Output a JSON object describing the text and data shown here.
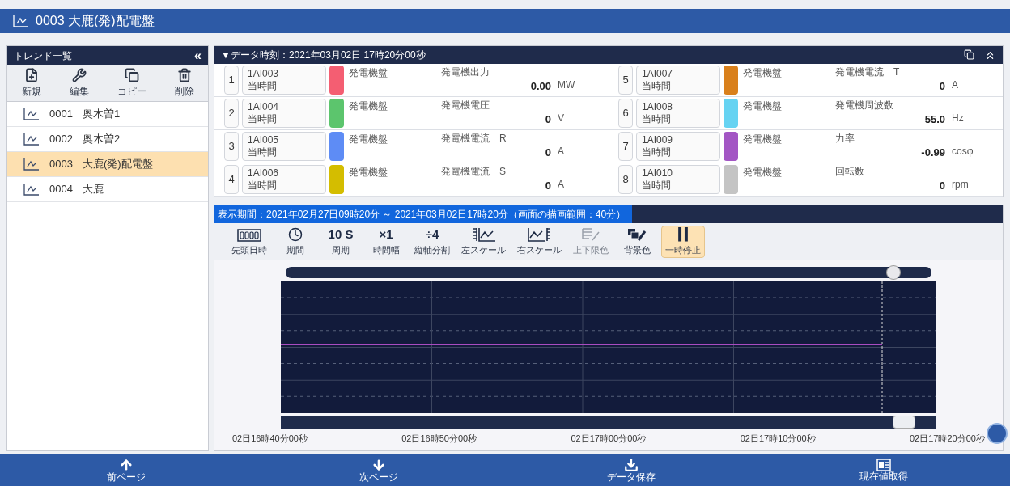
{
  "window": {
    "title": "0003 大鹿(発)配電盤"
  },
  "sidebar": {
    "title": "トレンド一覧",
    "collapse": "«",
    "tools": [
      {
        "kind": "new",
        "label": "新規"
      },
      {
        "kind": "edit",
        "label": "編集"
      },
      {
        "kind": "copy",
        "label": "コピー"
      },
      {
        "kind": "delete",
        "label": "削除"
      }
    ],
    "items": [
      {
        "code": "0001",
        "name": "奥木曽1",
        "selected": false
      },
      {
        "code": "0002",
        "name": "奥木曽2",
        "selected": false
      },
      {
        "code": "0003",
        "name": "大鹿(発)配電盤",
        "selected": true
      },
      {
        "code": "0004",
        "name": "大鹿",
        "selected": false
      }
    ]
  },
  "data_panel": {
    "title": "▼データ時刻：2021年03月02日 17時20分00秒",
    "channels": [
      {
        "no": "1",
        "tag": "1AI003",
        "mode": "当時間",
        "color": "#f45e72",
        "group": "発電機盤",
        "name": "発電機出力",
        "value": "0.00",
        "unit": "MW"
      },
      {
        "no": "2",
        "tag": "1AI004",
        "mode": "当時間",
        "color": "#5cc56d",
        "group": "発電機盤",
        "name": "発電機電圧",
        "value": "0",
        "unit": "V"
      },
      {
        "no": "3",
        "tag": "1AI005",
        "mode": "当時間",
        "color": "#5e8cf5",
        "group": "発電機盤",
        "name": "発電機電流",
        "phase": "R",
        "value": "0",
        "unit": "A"
      },
      {
        "no": "4",
        "tag": "1AI006",
        "mode": "当時間",
        "color": "#d4bd00",
        "group": "発電機盤",
        "name": "発電機電流",
        "phase": "S",
        "value": "0",
        "unit": "A"
      },
      {
        "no": "5",
        "tag": "1AI007",
        "mode": "当時間",
        "color": "#d9801c",
        "group": "発電機盤",
        "name": "発電機電流",
        "phase": "T",
        "value": "0",
        "unit": "A"
      },
      {
        "no": "6",
        "tag": "1AI008",
        "mode": "当時間",
        "color": "#66d3f2",
        "group": "発電機盤",
        "name": "発電機周波数",
        "value": "55.0",
        "unit": "Hz"
      },
      {
        "no": "7",
        "tag": "1AI009",
        "mode": "当時間",
        "color": "#a356c4",
        "group": "発電機盤",
        "name": "力率",
        "value": "-0.99",
        "unit": "cosφ"
      },
      {
        "no": "8",
        "tag": "1AI010",
        "mode": "当時間",
        "color": "#c4c4c4",
        "group": "発電機盤",
        "name": "回転数",
        "value": "0",
        "unit": "rpm"
      }
    ]
  },
  "trend": {
    "period": "表示期間：2021年02月27日09時20分 ～ 2021年03月02日17時20分（画面の描画範囲：40分）",
    "tools": [
      {
        "kind": "counter",
        "label": "先頭日時",
        "disabled": false,
        "selected": false
      },
      {
        "kind": "clock",
        "label": "期間",
        "disabled": false,
        "selected": false
      },
      {
        "kind": "glyph",
        "glyph": "10 S",
        "label": "周期",
        "disabled": false,
        "selected": false
      },
      {
        "kind": "glyph",
        "glyph": "×1",
        "label": "時間幅",
        "disabled": false,
        "selected": false
      },
      {
        "kind": "glyph",
        "glyph": "÷4",
        "label": "縦軸分割",
        "disabled": false,
        "selected": false
      },
      {
        "kind": "left-scale",
        "label": "左スケール",
        "disabled": false,
        "selected": false
      },
      {
        "kind": "right-scale",
        "label": "右スケール",
        "disabled": false,
        "selected": false
      },
      {
        "kind": "limit-color",
        "label": "上下限色",
        "disabled": true,
        "selected": false
      },
      {
        "kind": "background",
        "label": "背景色",
        "disabled": false,
        "selected": false
      },
      {
        "kind": "pause",
        "label": "一時停止",
        "disabled": false,
        "selected": true
      }
    ],
    "time_labels": [
      "02日16時40分00秒",
      "02日16時50分00秒",
      "02日17時00分00秒",
      "02日17時10分00秒",
      "02日17時20分00秒"
    ]
  },
  "footer": [
    {
      "kind": "up",
      "label": "前ページ"
    },
    {
      "kind": "down",
      "label": "次ページ"
    },
    {
      "kind": "save",
      "label": "データ保存"
    },
    {
      "kind": "current",
      "label": "現在値取得"
    }
  ]
}
